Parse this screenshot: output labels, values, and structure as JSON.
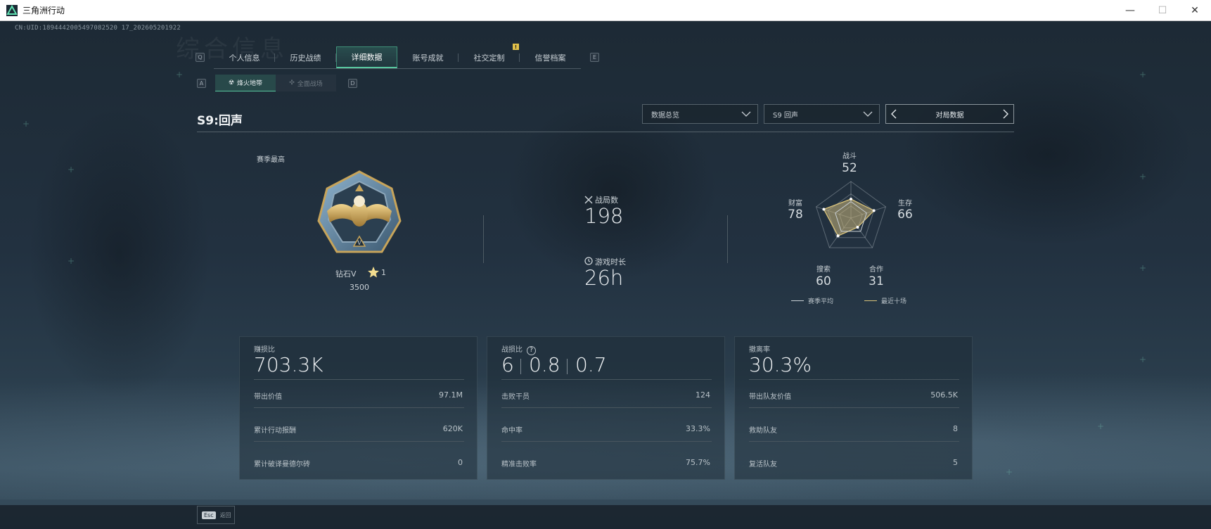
{
  "window": {
    "title": "三角洲行动",
    "minimize": "—",
    "maximize": "☐",
    "close": "✕"
  },
  "uid": "CN:UID:1894442005497082520 17_202605201922",
  "ghost_title": "综合信息",
  "tabs": {
    "key_left": "Q",
    "key_right": "E",
    "items": [
      {
        "label": "个人信息"
      },
      {
        "label": "历史战绩"
      },
      {
        "label": "详细数据",
        "active": true
      },
      {
        "label": "账号成就"
      },
      {
        "label": "社交定制"
      },
      {
        "label": "信誉档案"
      }
    ],
    "badge": "!"
  },
  "subtabs": {
    "key_left": "A",
    "key_right": "D",
    "items": [
      {
        "label": "烽火地带",
        "icon": "flame-zone-icon",
        "active": true
      },
      {
        "label": "全面战场",
        "icon": "battlefield-icon"
      }
    ]
  },
  "season": {
    "title": "S9:回声"
  },
  "filters": {
    "overview": "数据总览",
    "season": "S9 回声",
    "match_data": "对局数据"
  },
  "rank": {
    "label": "赛季最高",
    "name": "钻石V",
    "stars": "1",
    "score": "3500"
  },
  "stats": {
    "matches_label": "战局数",
    "matches_value": "198",
    "playtime_label": "游戏时长",
    "playtime_value": "26h"
  },
  "radar": {
    "axes": [
      {
        "label": "战斗",
        "value": "52"
      },
      {
        "label": "生存",
        "value": "66"
      },
      {
        "label": "合作",
        "value": "31"
      },
      {
        "label": "搜索",
        "value": "60"
      },
      {
        "label": "财富",
        "value": "78"
      }
    ],
    "series_values": {
      "season_avg": [
        0.45,
        0.45,
        0.45,
        0.45,
        0.45
      ],
      "recent_ten": [
        0.52,
        0.66,
        0.31,
        0.6,
        0.78
      ]
    },
    "legend": {
      "season_avg": "赛季平均",
      "recent_ten": "最近十场"
    },
    "colors": {
      "season_avg": "#c9d0d5",
      "recent_ten": "#d8c27a",
      "fill": "#c9b57a"
    }
  },
  "cards": {
    "profit": {
      "title": "赚损比",
      "main": "703.3K",
      "rows": [
        {
          "label": "带出价值",
          "value": "97.1M"
        },
        {
          "label": "累计行动报酬",
          "value": "620K"
        },
        {
          "label": "累计破译曼德尔砖",
          "value": "0"
        }
      ]
    },
    "combat": {
      "title": "战损比",
      "help": "?",
      "ratios": [
        "6",
        "0.8",
        "0.7"
      ],
      "rows": [
        {
          "label": "击败干员",
          "value": "124"
        },
        {
          "label": "命中率",
          "value": "33.3%"
        },
        {
          "label": "精准击败率",
          "value": "75.7%"
        }
      ]
    },
    "extract": {
      "title": "撤离率",
      "main": "30.3%",
      "rows": [
        {
          "label": "带出队友价值",
          "value": "506.5K"
        },
        {
          "label": "救助队友",
          "value": "8"
        },
        {
          "label": "复活队友",
          "value": "5"
        }
      ]
    }
  },
  "footer": {
    "esc_key": "Esc",
    "esc_label": "返回"
  }
}
